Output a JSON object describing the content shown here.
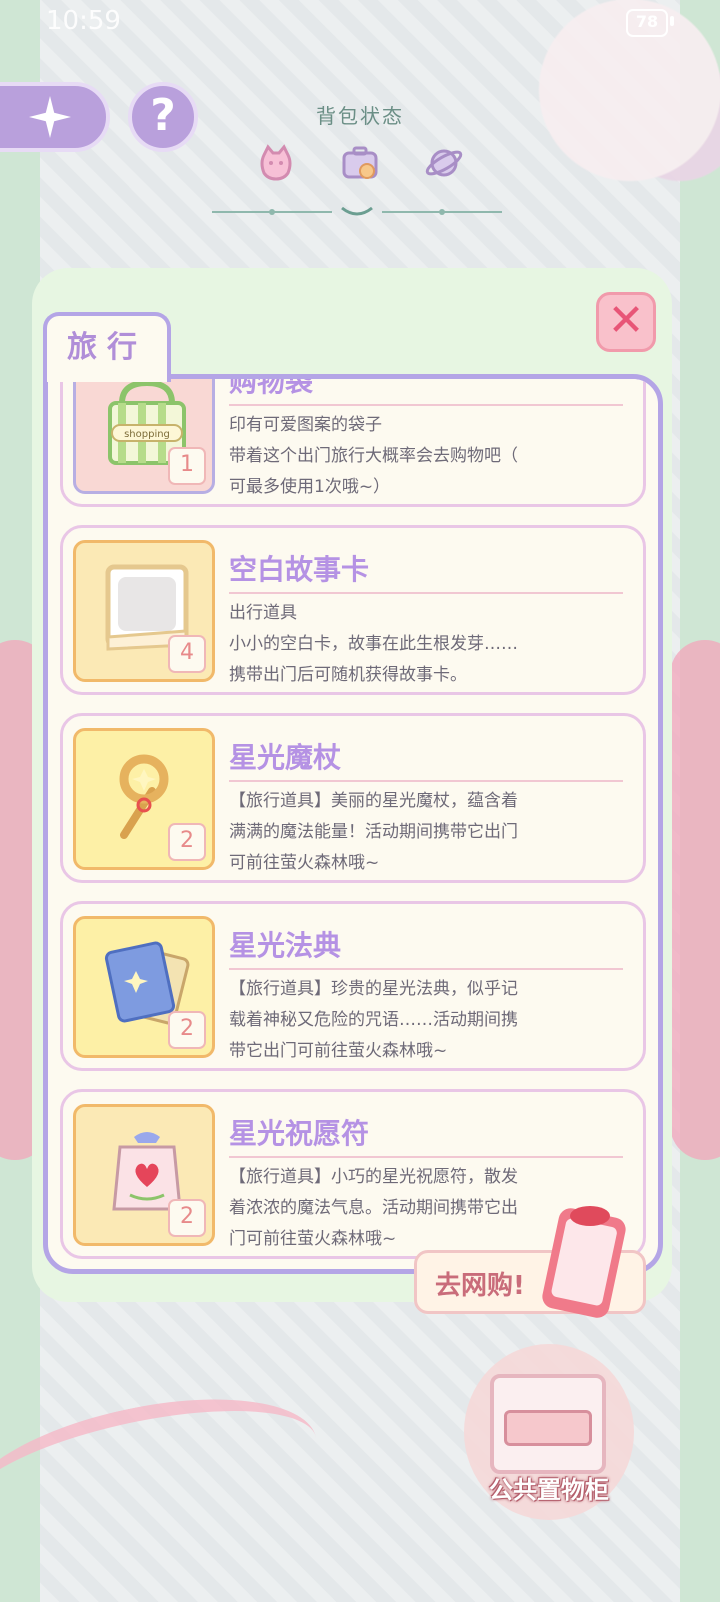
{
  "status_bar": {
    "time": "10:59",
    "battery": "78"
  },
  "header": {
    "title": "背包状态",
    "status_icons": [
      "cat-icon",
      "suitcase-icon",
      "planet-icon"
    ]
  },
  "panel": {
    "tab_label": "旅行",
    "close_label": "✕",
    "items": [
      {
        "name": "购物袋",
        "desc_lines": [
          "印有可爱图案的袋子",
          "带着这个出门旅行大概率会去购物吧（",
          "可最多使用1次哦~）"
        ],
        "qty": "1",
        "icon": "shopping-bag-icon",
        "art_text": "shopping"
      },
      {
        "name": "空白故事卡",
        "desc_lines": [
          "出行道具",
          "小小的空白卡，故事在此生根发芽……",
          "携带出门后可随机获得故事卡。"
        ],
        "qty": "4",
        "icon": "story-card-icon"
      },
      {
        "name": "星光魔杖",
        "desc_lines": [
          "【旅行道具】美丽的星光魔杖，蕴含着",
          "满满的魔法能量！活动期间携带它出门",
          "可前往萤火森林哦~"
        ],
        "qty": "2",
        "icon": "magic-wand-icon"
      },
      {
        "name": "星光法典",
        "desc_lines": [
          "【旅行道具】珍贵的星光法典，似乎记",
          "载着神秘又危险的咒语……活动期间携",
          "带它出门可前往萤火森林哦~"
        ],
        "qty": "2",
        "icon": "spellbook-icon"
      },
      {
        "name": "星光祝愿符",
        "desc_lines": [
          "【旅行道具】小巧的星光祝愿符，散发",
          "着浓浓的魔法气息。活动期间携带它出",
          "门可前往萤火森林哦~"
        ],
        "qty": "2",
        "icon": "charm-icon"
      }
    ]
  },
  "shop_button": {
    "label": "去网购!"
  },
  "locker_button": {
    "label": "公共置物柜"
  },
  "colors": {
    "accent": "#b592e4",
    "panel_bg": "#e7f6e2",
    "close": "#e85577"
  }
}
